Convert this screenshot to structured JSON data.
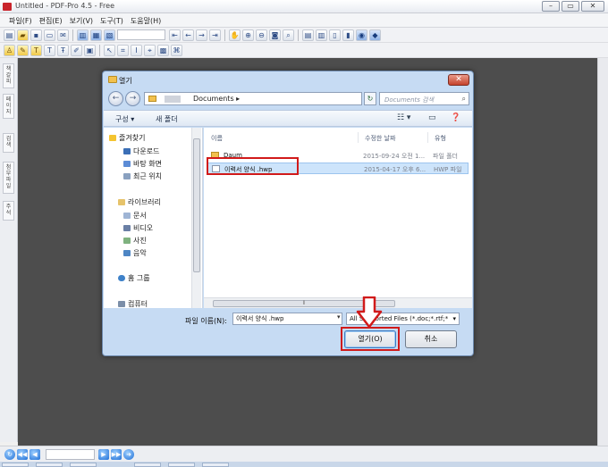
{
  "window": {
    "title": "Untitled - PDF-Pro 4.5 - Free",
    "min": "–",
    "max": "▭",
    "close": "✕"
  },
  "menu": [
    "파일(F)",
    "편집(E)",
    "보기(V)",
    "도구(T)",
    "도움말(H)"
  ],
  "sidetabs": [
    "책갈피",
    "페이지",
    "검색",
    "첨부파일",
    "주석"
  ],
  "dialog": {
    "title": "열기",
    "close": "✕",
    "address": {
      "path": "Documents ▸",
      "search_placeholder": "Documents 검색"
    },
    "commands": {
      "organize": "구성 ▾",
      "new_folder": "새 폴더"
    },
    "nav": {
      "favorites": "즐겨찾기",
      "downloads": "다운로드",
      "desktop": "바탕 화면",
      "recent": "최근 위치",
      "libraries": "라이브러리",
      "documents": "문서",
      "videos": "비디오",
      "pictures": "사진",
      "music": "음악",
      "homegroup": "홈 그룹",
      "computer": "컴퓨터"
    },
    "columns": {
      "name": "이름",
      "date": "수정한 날짜",
      "type": "유형"
    },
    "files": [
      {
        "name": "Daum",
        "date": "2015-09-24 오전 1...",
        "type": "파일 폴더"
      },
      {
        "name": "이력서 양식 .hwp",
        "date": "2015-04-17 오후 6...",
        "type": "HWP 파일"
      }
    ],
    "filename_label": "파일 이름(N):",
    "filename_value": "이력서 양식 .hwp",
    "filetype": "All Supported Files (*.doc;*.rtf;*",
    "open_button": "열기(O)",
    "cancel_button": "취소"
  }
}
